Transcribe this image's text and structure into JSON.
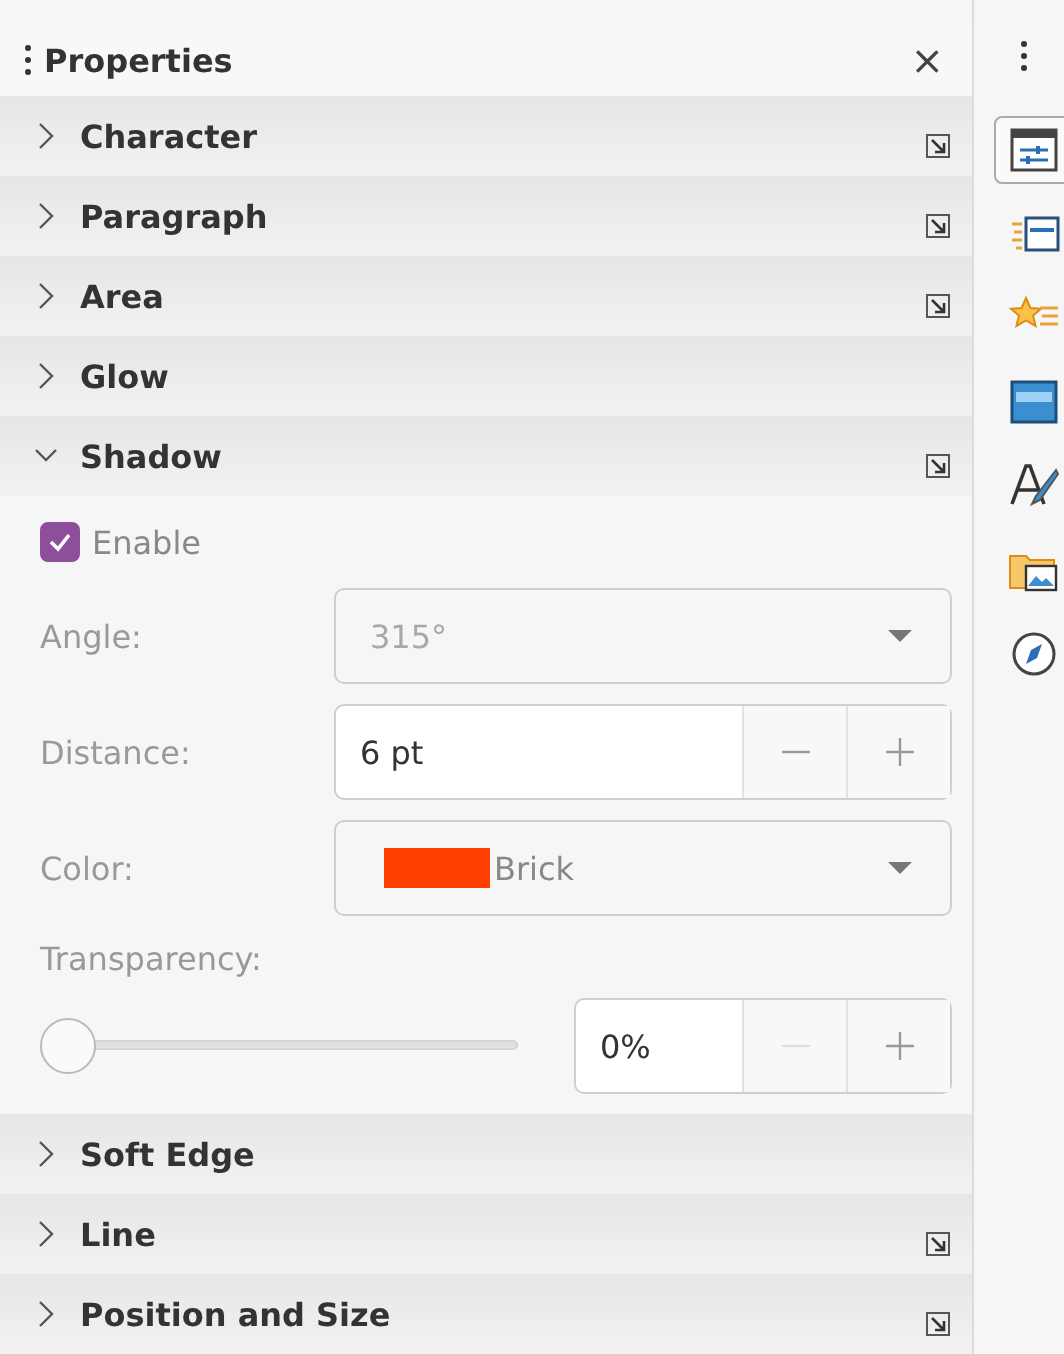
{
  "panel": {
    "title": "Properties",
    "close": "×"
  },
  "sections": [
    {
      "title": "Character",
      "expanded": false,
      "more_options": true
    },
    {
      "title": "Paragraph",
      "expanded": false,
      "more_options": true
    },
    {
      "title": "Area",
      "expanded": false,
      "more_options": true
    },
    {
      "title": "Glow",
      "expanded": false,
      "more_options": false
    },
    {
      "title": "Shadow",
      "expanded": true,
      "more_options": true,
      "content": {
        "enable": {
          "label": "Enable",
          "checked": true
        },
        "fields": [
          {
            "kind": "dropdown",
            "label": "Angle:",
            "value": "315°",
            "disabled": true
          },
          {
            "kind": "spin",
            "label": "Distance:",
            "value": "6 pt",
            "disabled": false
          },
          {
            "kind": "color",
            "label": "Color:",
            "value": "Brick",
            "color": "#ff4000",
            "disabled": false
          }
        ],
        "transparency": {
          "label": "Transparency:",
          "level": 0,
          "value": "0%",
          "minus_disabled": true
        }
      }
    },
    {
      "title": "Soft Edge",
      "expanded": false,
      "more_options": false
    },
    {
      "title": "Line",
      "expanded": false,
      "more_options": true
    },
    {
      "title": "Position and Size",
      "expanded": false,
      "more_options": true
    }
  ],
  "tabs": [
    {
      "kind": "properties",
      "selected": true
    },
    {
      "kind": "slide-transition",
      "selected": false
    },
    {
      "kind": "animation",
      "selected": false
    },
    {
      "kind": "master-slides",
      "selected": false
    },
    {
      "kind": "styles",
      "selected": false
    },
    {
      "kind": "gallery",
      "selected": false
    },
    {
      "kind": "navigator",
      "selected": false
    }
  ]
}
